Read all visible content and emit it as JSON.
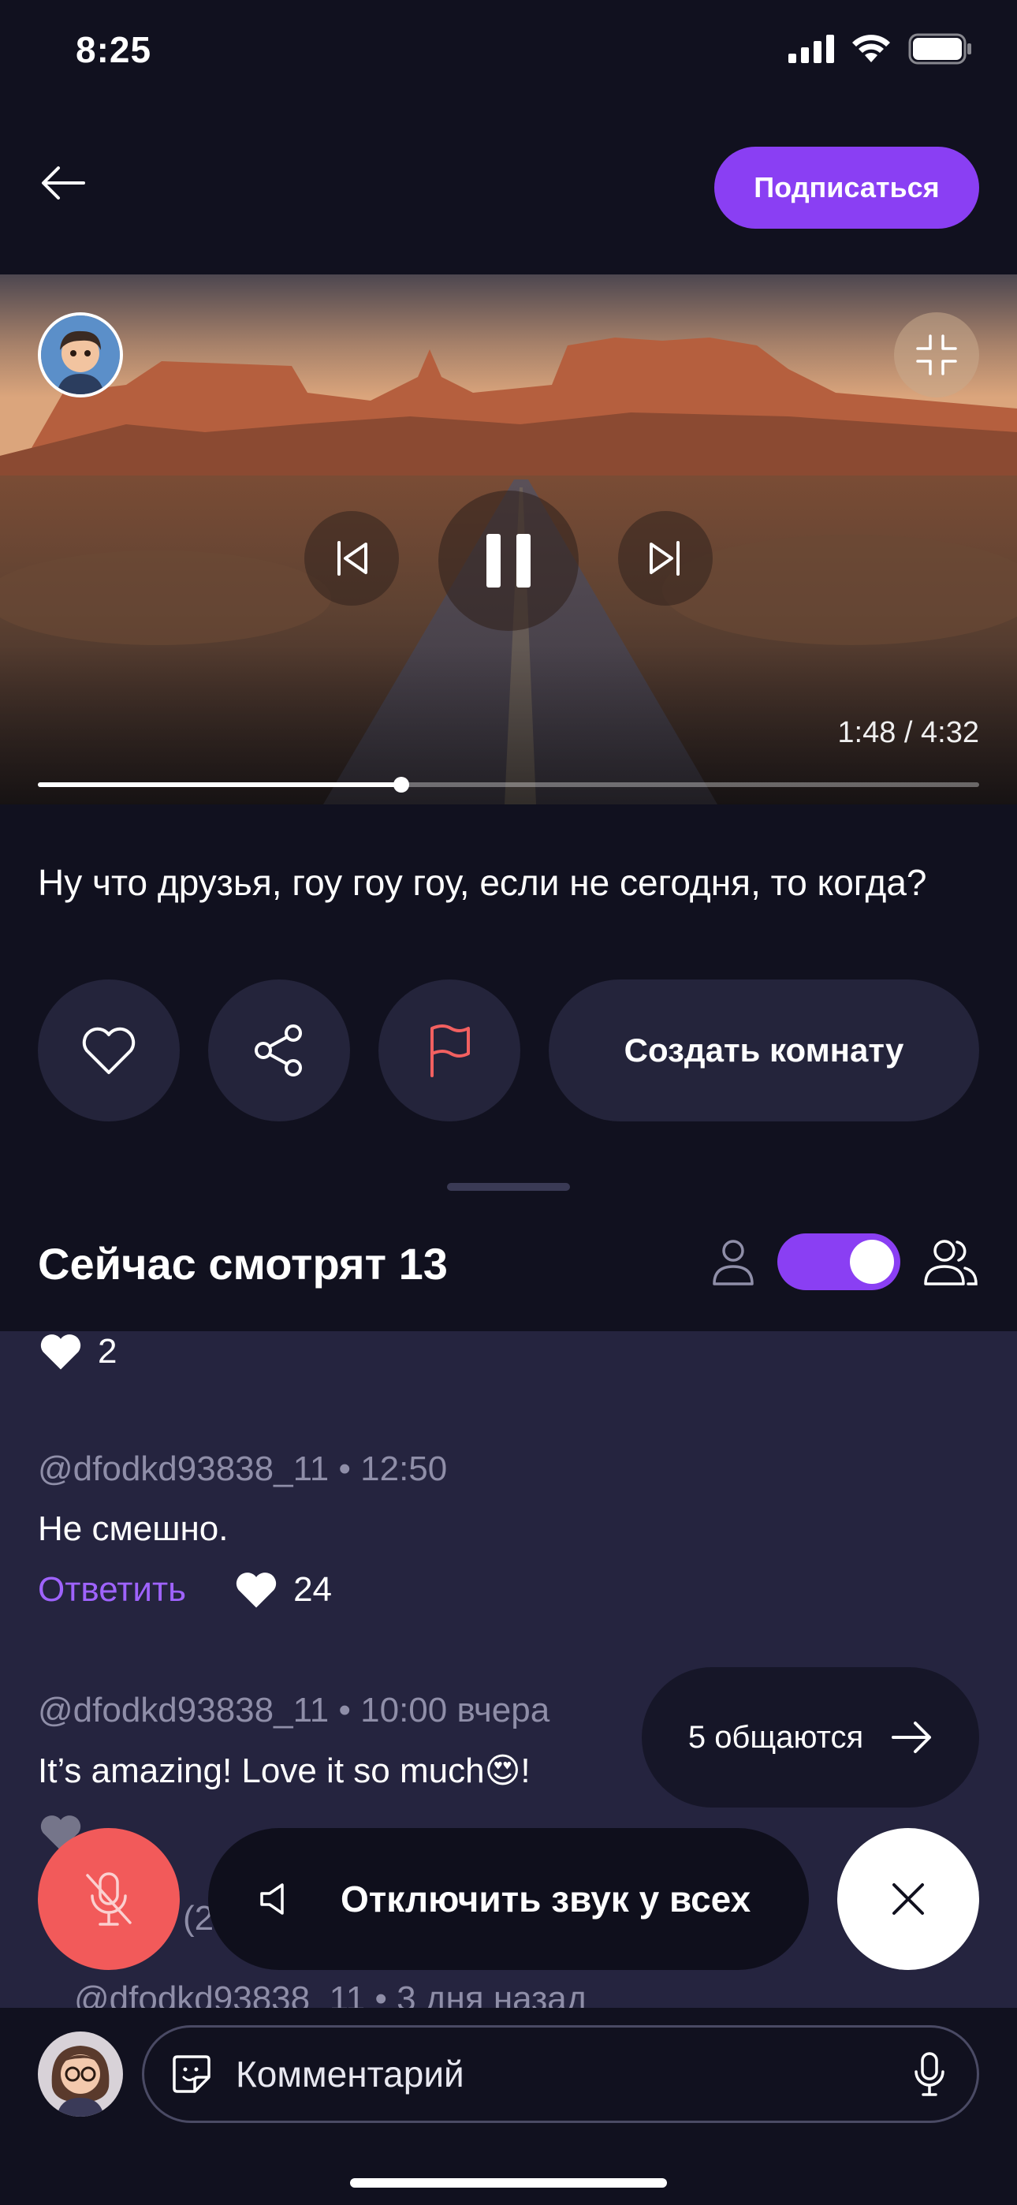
{
  "status_bar": {
    "time": "8:25"
  },
  "header": {
    "subscribe_label": "Подписаться"
  },
  "player": {
    "time_display": "1:48 / 4:32",
    "progress": 0.386
  },
  "video": {
    "title": "Ну что друзья, гоу гоу гоу, если не сегодня, то когда?"
  },
  "actions": {
    "create_room_label": "Создать комнату"
  },
  "watching": {
    "title": "Сейчас смотрят 13",
    "toggle_on": true
  },
  "comments": {
    "top_likes": "2",
    "items": [
      {
        "meta": "@dfodkd93838_11 • 12:50",
        "text": "Не смешно.",
        "reply_label": "Ответить",
        "likes": "24"
      },
      {
        "meta": "@dfodkd93838_11 • 10:00 вчера",
        "text": "It’s amazing! Love it so much😍!"
      },
      {
        "meta": "@dfodkd93838_11 • 3 дня назад"
      }
    ],
    "partial_text": "(2"
  },
  "chat_pill": {
    "label": "5 общаются"
  },
  "mute_all": {
    "label": "Отключить звук у всех"
  },
  "comment_input": {
    "placeholder": "Комментарий"
  },
  "colors": {
    "accent": "#8a3ff3",
    "background": "#11111f",
    "comments_bg": "#25243f",
    "danger": "#f25a5a",
    "report": "#f26060",
    "link": "#9f63ff"
  },
  "icons": {
    "back": "arrow-left-icon",
    "collapse": "collapse-icon",
    "prev": "skip-previous-icon",
    "pause": "pause-icon",
    "next": "skip-next-icon",
    "like": "heart-icon",
    "share": "share-icon",
    "report": "flag-icon",
    "single_view": "person-icon",
    "group_view": "people-icon",
    "mic_off": "mic-off-icon",
    "speaker": "speaker-icon",
    "close": "close-icon",
    "sticker": "sticker-icon",
    "mic": "mic-icon"
  }
}
